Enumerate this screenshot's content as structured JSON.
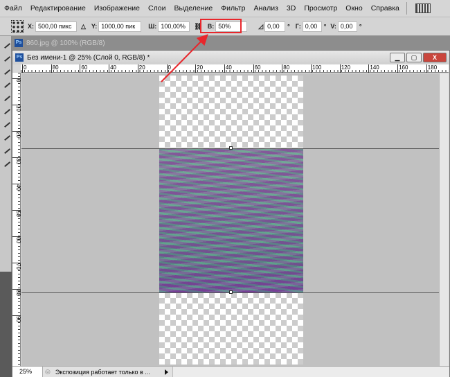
{
  "menu": [
    "Файл",
    "Редактирование",
    "Изображение",
    "Слои",
    "Выделение",
    "Фильтр",
    "Анализ",
    "3D",
    "Просмотр",
    "Окно",
    "Справка"
  ],
  "options": {
    "x_label": "X:",
    "x": "500,00 пикс",
    "y_label": "Y:",
    "y": "1000,00 пик",
    "w_label": "Ш:",
    "w": "100,00%",
    "h_label": "В:",
    "h": "50%",
    "angle": "0,00",
    "hskew_label": "Г:",
    "hskew": "0,00",
    "vskew_label": "V:",
    "vskew": "0,00",
    "deg": "°"
  },
  "tabs": {
    "ps": "Ps",
    "bg_doc": "860.jpg @ 100% (RGB/8)",
    "doc": "Без имени-1 @ 25% (Слой 0, RGB/8) *"
  },
  "hruler": [
    "0",
    "80",
    "60",
    "40",
    "20",
    "0",
    "20",
    "40",
    "60",
    "80",
    "100",
    "120",
    "140",
    "160",
    "180"
  ],
  "vruler": [
    "0",
    "10",
    "20",
    "30",
    "40",
    "50",
    "60",
    "70",
    "80",
    "90"
  ],
  "status": {
    "zoom": "25%",
    "message": "Экспозиция работает только в ..."
  },
  "colors": {
    "annotation": "#e8262b"
  }
}
